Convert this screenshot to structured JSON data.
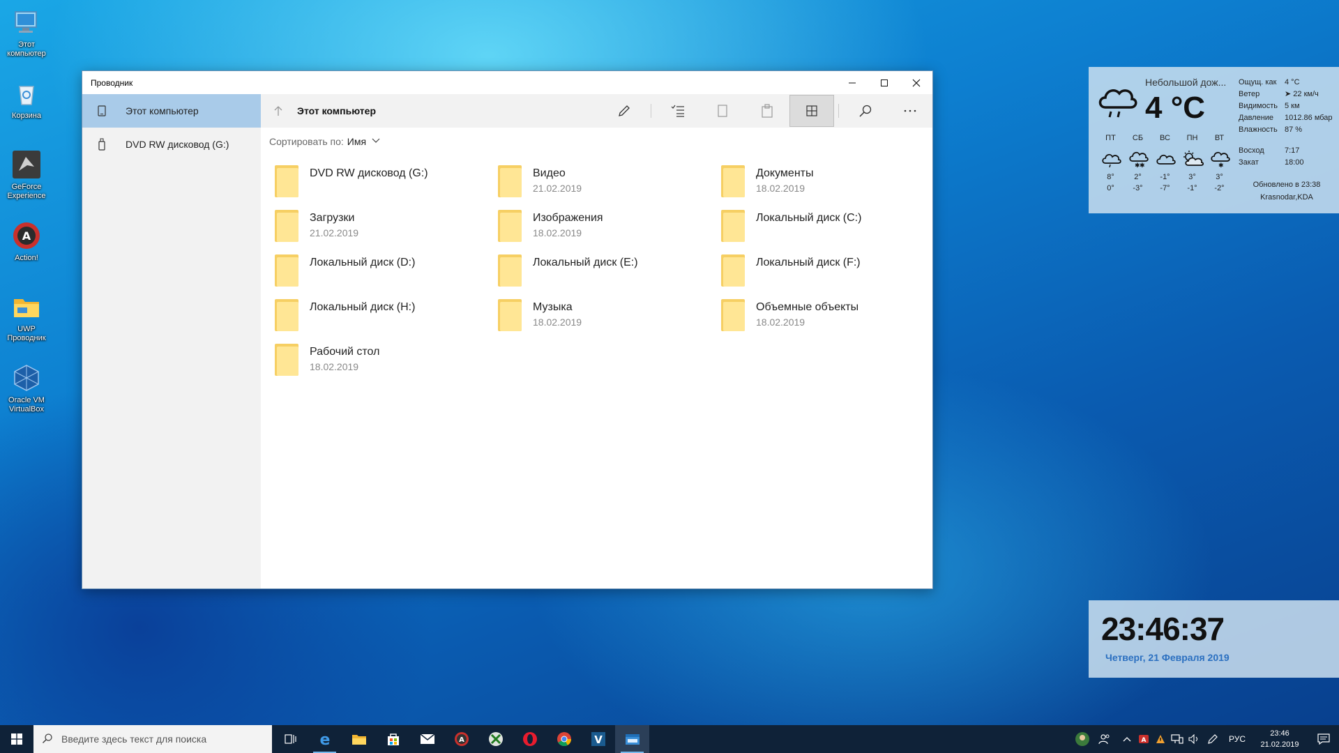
{
  "desktop": {
    "icons": [
      {
        "label": "Этот компьютер",
        "icon": "computer-icon"
      },
      {
        "label": "Корзина",
        "icon": "recycle-bin-icon"
      },
      {
        "label": "GeForce Experience",
        "icon": "geforce-icon"
      },
      {
        "label": "Action!",
        "icon": "action-recorder-icon"
      },
      {
        "label": "UWP Проводник",
        "icon": "uwp-explorer-icon"
      },
      {
        "label": "Oracle VM VirtualBox",
        "icon": "virtualbox-icon"
      }
    ]
  },
  "window": {
    "title": "Проводник",
    "controls": {
      "minimize": "minimize-icon",
      "maximize": "maximize-icon",
      "close": "close-icon"
    },
    "nav": [
      {
        "label": "Этот компьютер",
        "icon": "phone-computer-icon",
        "active": true
      },
      {
        "label": "DVD RW дисковод (G:)",
        "icon": "usb-drive-icon",
        "active": false
      }
    ],
    "breadcrumb": "Этот компьютер",
    "toolbar": [
      "rename-icon",
      "select-icon",
      "copy-icon",
      "paste-icon",
      "view-grid-icon",
      "search-icon",
      "more-icon"
    ],
    "sort": {
      "label": "Сортировать по:",
      "value": "Имя"
    },
    "items": [
      {
        "name": "DVD RW дисковод (G:)",
        "date": ""
      },
      {
        "name": "Видео",
        "date": "21.02.2019"
      },
      {
        "name": "Документы",
        "date": "18.02.2019"
      },
      {
        "name": "Загрузки",
        "date": "21.02.2019"
      },
      {
        "name": "Изображения",
        "date": "18.02.2019"
      },
      {
        "name": "Локальный диск (C:)",
        "date": ""
      },
      {
        "name": "Локальный диск (D:)",
        "date": ""
      },
      {
        "name": "Локальный диск (E:)",
        "date": ""
      },
      {
        "name": "Локальный диск (F:)",
        "date": ""
      },
      {
        "name": "Локальный диск (H:)",
        "date": ""
      },
      {
        "name": "Музыка",
        "date": "18.02.2019"
      },
      {
        "name": "Объемные объекты",
        "date": "18.02.2019"
      },
      {
        "name": "Рабочий стол",
        "date": "18.02.2019"
      }
    ]
  },
  "weather": {
    "condition": "Небольшой дож...",
    "temp": "4 °C",
    "details": [
      {
        "k": "Ощущ. как",
        "v": "4 °C"
      },
      {
        "k": "Ветер",
        "v": "➤ 22 км/ч"
      },
      {
        "k": "Видимость",
        "v": "5 км"
      },
      {
        "k": "Давление",
        "v": "1012.86 мбар"
      },
      {
        "k": "Влажность",
        "v": "87 %"
      }
    ],
    "days": [
      {
        "d": "ПТ",
        "hi": "8°",
        "lo": "0°",
        "icon": "cloud-icon"
      },
      {
        "d": "СБ",
        "hi": "2°",
        "lo": "-3°",
        "icon": "snow-cloud-icon"
      },
      {
        "d": "ВС",
        "hi": "-1°",
        "lo": "-7°",
        "icon": "cloud-icon"
      },
      {
        "d": "ПН",
        "hi": "3°",
        "lo": "-1°",
        "icon": "partly-sunny-icon"
      },
      {
        "d": "ВТ",
        "hi": "3°",
        "lo": "-2°",
        "icon": "snow-cloud-icon"
      }
    ],
    "sun": [
      {
        "k": "Восход",
        "v": "7:17"
      },
      {
        "k": "Закат",
        "v": "18:00"
      }
    ],
    "updated": "Обновлено в 23:38",
    "location": "Krasnodar,KDA"
  },
  "clock": {
    "time": "23:46:37",
    "date": "Четверг, 21 Февраля 2019"
  },
  "taskbar": {
    "search_placeholder": "Введите здесь текст для поиска",
    "apps": [
      "task-view-icon",
      "edge-icon",
      "file-explorer-icon",
      "store-icon",
      "mail-icon",
      "action-app-icon",
      "xbox-icon",
      "opera-icon",
      "chrome-icon",
      "vegas-icon",
      "uwp-explorer-app-icon"
    ],
    "lang": "РУС",
    "time": "23:46",
    "date": "21.02.2019"
  }
}
